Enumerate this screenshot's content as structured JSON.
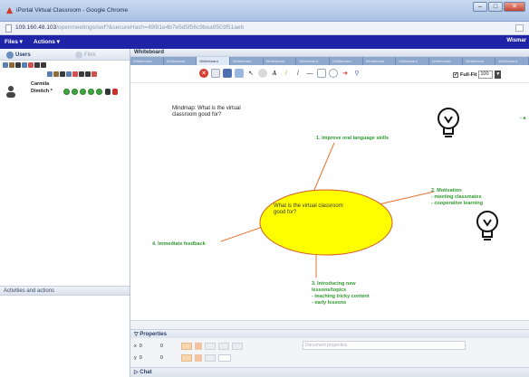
{
  "window": {
    "title": "iPortal Virtual Classroom - Google Chrome",
    "url_main": "109.160.48.103",
    "url_rest": "/openmeetings/swf?&secureHash=49f81e4b7e5d5f56c9bea9503f51aeb",
    "buttons": [
      "–",
      "□",
      "✕"
    ]
  },
  "appbar": {
    "menu_files": "Files ▾",
    "menu_actions": "Actions ▾",
    "user": "Wismar"
  },
  "left": {
    "tab_users": "Users",
    "tab_files": "Files",
    "users": [
      {
        "name1": "Carmila",
        "name2": "Dimitch *"
      }
    ],
    "activities_label": "Activities and actions"
  },
  "whiteboard": {
    "header": "Whiteboard",
    "tabs": [
      "Whiteboard",
      "Whiteboard",
      "Whiteboard",
      "Whiteboard",
      "Whiteboard",
      "Whiteboard",
      "Whiteboard",
      "Whiteboard",
      "Whiteboard",
      "Whiteboard",
      "Whiteboard",
      "Whiteboard"
    ],
    "fullfit_label": "Full-Fit",
    "zoom_value": "100",
    "mindmap": {
      "title": "Mindmap: What is the virtual classroom good for?",
      "center": "What is the virtual classroom good for?",
      "node1": "1. Improve oral language skills",
      "node2_title": "2. Motivation",
      "node2_line1": "- meeting classmates",
      "node2_line2": "- cooperative learning",
      "node3_title": "3. Introducing new lessons/topics",
      "node3_line1": "- teaching tricky content",
      "node3_line2": "- early lessons",
      "node4": "4. Immediate feedback",
      "edge_text": "- a"
    }
  },
  "properties": {
    "title": "Properties",
    "x_label": "x",
    "x_value": "0",
    "y_label": "y",
    "y_value": "0",
    "w_value": "0",
    "h_value": "0",
    "doc_placeholder": "Document properties"
  },
  "chat": {
    "label": "Chat"
  },
  "colors": {
    "app_blue": "#1f24a6",
    "ellipse_fill": "#ffff00",
    "mindmap_green": "#2f9a2f",
    "connector_orange": "#e8732b"
  }
}
